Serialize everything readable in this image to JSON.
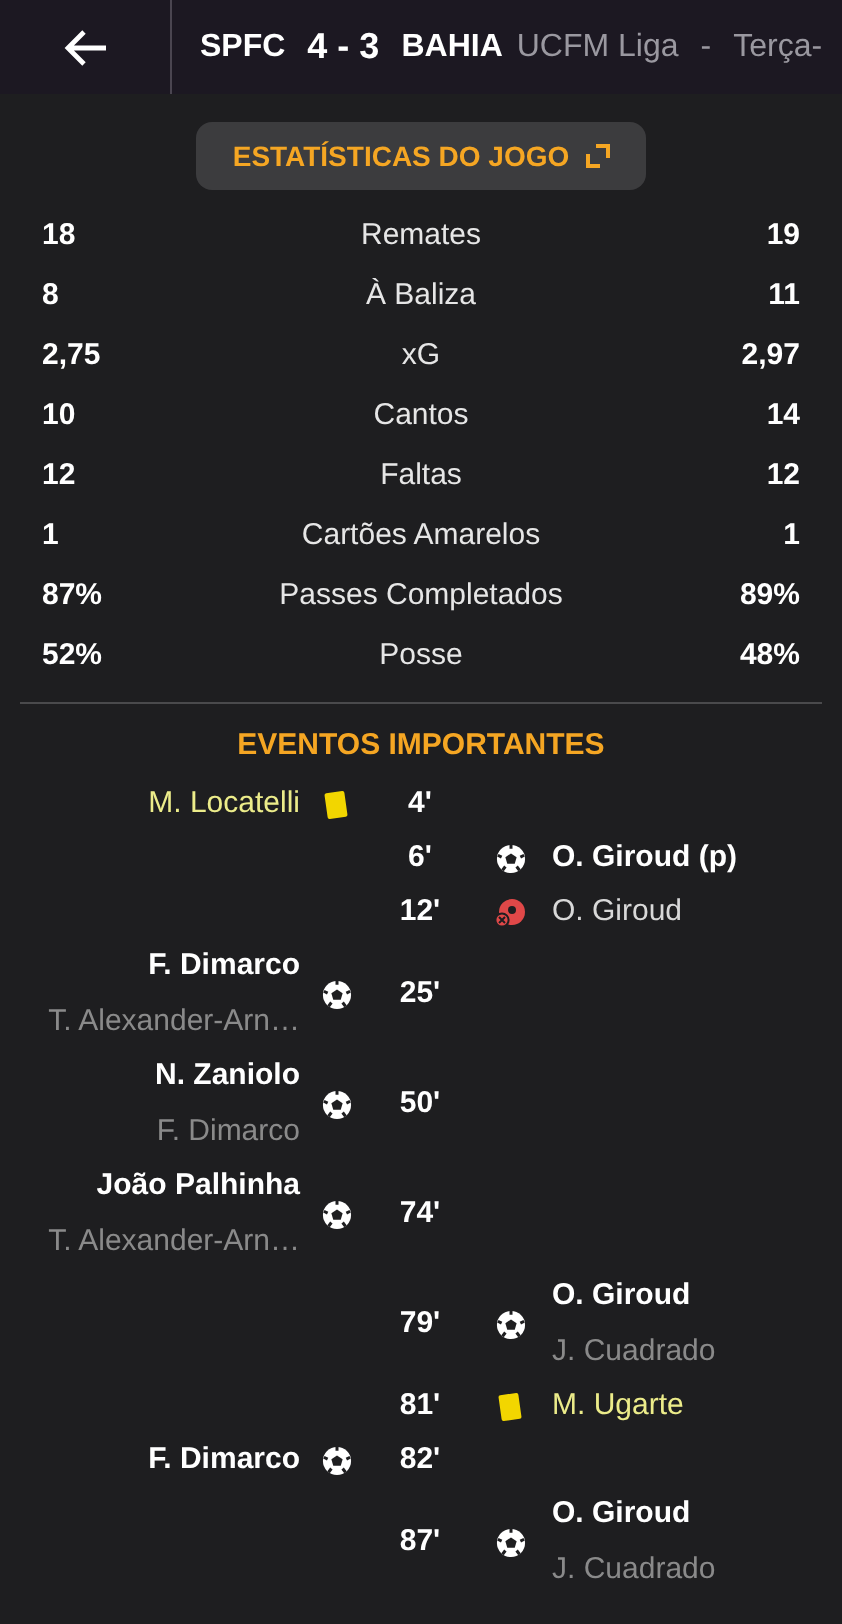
{
  "header": {
    "home": "SPFC",
    "score": "4 - 3",
    "away": "BAHIA",
    "competition": "UCFM Liga",
    "separator": "-",
    "date": "Terça-"
  },
  "stats_button": {
    "label": "ESTATÍSTICAS DO JOGO"
  },
  "stats": [
    {
      "home": "18",
      "label": "Remates",
      "away": "19"
    },
    {
      "home": "8",
      "label": "À Baliza",
      "away": "11"
    },
    {
      "home": "2,75",
      "label": "xG",
      "away": "2,97"
    },
    {
      "home": "10",
      "label": "Cantos",
      "away": "14"
    },
    {
      "home": "12",
      "label": "Faltas",
      "away": "12"
    },
    {
      "home": "1",
      "label": "Cartões Amarelos",
      "away": "1"
    },
    {
      "home": "87%",
      "label": "Passes Completados",
      "away": "89%"
    },
    {
      "home": "52%",
      "label": "Posse",
      "away": "48%"
    }
  ],
  "events_title": "EVENTOS IMPORTANTES",
  "events": [
    {
      "home_team": true,
      "kind": "yellow_card",
      "player": "M. Locatelli",
      "minute": "4'"
    },
    {
      "home_team": false,
      "kind": "goal",
      "player": "O. Giroud (p)",
      "minute": "6'"
    },
    {
      "home_team": false,
      "kind": "missed_penalty",
      "player": "O. Giroud",
      "minute": "12'"
    },
    {
      "home_team": true,
      "kind": "goal",
      "player": "F. Dimarco",
      "assist": "T. Alexander-Arn…",
      "minute": "25'"
    },
    {
      "home_team": true,
      "kind": "goal",
      "player": "N. Zaniolo",
      "assist": "F. Dimarco",
      "minute": "50'"
    },
    {
      "home_team": true,
      "kind": "goal",
      "player": "João Palhinha",
      "assist": "T. Alexander-Arn…",
      "minute": "74'"
    },
    {
      "home_team": false,
      "kind": "goal",
      "player": "O. Giroud",
      "assist": "J. Cuadrado",
      "minute": "79'"
    },
    {
      "home_team": false,
      "kind": "yellow_card",
      "player": "M. Ugarte",
      "minute": "81'"
    },
    {
      "home_team": true,
      "kind": "goal",
      "player": "F. Dimarco",
      "minute": "82'"
    },
    {
      "home_team": false,
      "kind": "goal",
      "player": "O. Giroud",
      "assist": "J. Cuadrado",
      "minute": "87'"
    }
  ]
}
